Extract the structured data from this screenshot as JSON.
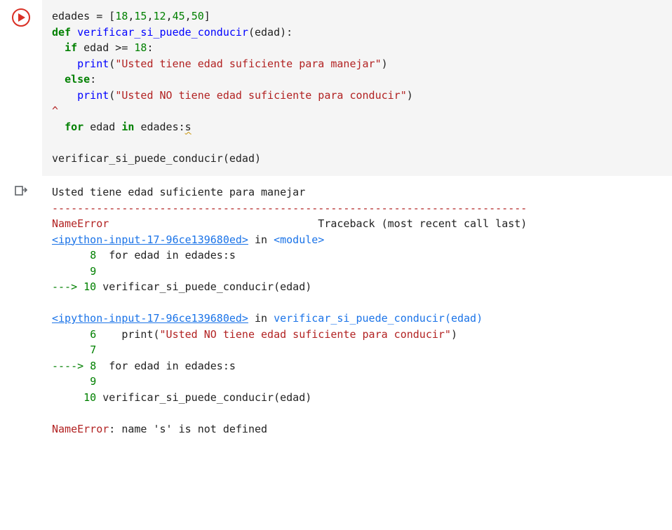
{
  "code": {
    "l1": {
      "ident": "edades",
      "assign": " = [",
      "n1": "18",
      "c1": ",",
      "n2": "15",
      "c2": ",",
      "n3": "12",
      "c3": ",",
      "n4": "45",
      "c4": ",",
      "n5": "50",
      "close": "]"
    },
    "l2": {
      "kw": "def ",
      "fn": "verificar_si_puede_conducir",
      "open": "(",
      "param": "edad",
      "close": "):"
    },
    "l3": {
      "indent": "  ",
      "kw": "if",
      "sp": " ",
      "ident": "edad",
      "op": " >= ",
      "num": "18",
      "colon": ":"
    },
    "l4": {
      "indent": "    ",
      "fn": "print",
      "open": "(",
      "str": "\"Usted tiene edad suficiente para manejar\"",
      "close": ")"
    },
    "l5": {
      "indent": "  ",
      "kw": "else",
      "colon": ":"
    },
    "l6": {
      "indent": "    ",
      "fn": "print",
      "open": "(",
      "str": "\"Usted NO tiene edad suficiente para conducir\"",
      "close": ")"
    },
    "l8": {
      "indent": "  ",
      "caret": "^",
      "kw": "for",
      "sp": " ",
      "ident": "edad",
      "in_sp": " ",
      "in": "in",
      "sp2": " ",
      "iter": "edades",
      "colon": ":",
      "tail": "s"
    },
    "l10": {
      "fn": "verificar_si_puede_conducir",
      "open": "(",
      "arg": "edad",
      "close": ")"
    }
  },
  "output": {
    "stdout": "Usted tiene edad suficiente para manejar",
    "dash": "---------------------------------------------------------------------------",
    "err_head": {
      "name": "NameError",
      "right": "Traceback (most recent call last)"
    },
    "frame1": {
      "link": "<ipython-input-17-96ce139680ed>",
      "in_word": " in ",
      "mod": "<module>",
      "l8": {
        "lineno": "8",
        "body": "  for edad in edades:s"
      },
      "l9": {
        "lineno": "9"
      },
      "l10": {
        "arrow": "---> ",
        "lineno": "10",
        "body": " verificar_si_puede_conducir(edad)"
      }
    },
    "frame2": {
      "link": "<ipython-input-17-96ce139680ed>",
      "in_word": " in ",
      "fn_open": "verificar_si_puede_conducir",
      "arg": "(edad)",
      "l6": {
        "lineno": "6",
        "prefix": "    print(",
        "str": "\"Usted NO tiene edad suficiente para conducir\"",
        "suffix": ")"
      },
      "l7": {
        "lineno": "7"
      },
      "l8": {
        "arrow": "----> ",
        "lineno": "8",
        "body": "  for edad in edades:s"
      },
      "l9": {
        "lineno": "9"
      },
      "l10": {
        "lineno": "10",
        "body": " verificar_si_puede_conducir(edad)"
      }
    },
    "final": {
      "name": "NameError",
      "msg": ": name 's' is not defined"
    }
  }
}
